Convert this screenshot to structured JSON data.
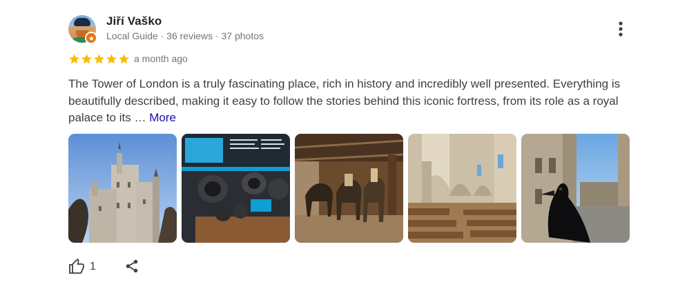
{
  "review": {
    "author": {
      "name": "Jiří Vaško",
      "meta": "Local Guide · 36 reviews · 37 photos",
      "avatar_icon": "user-avatar-icon",
      "badge_icon": "local-guide-star-icon"
    },
    "rating": {
      "stars": 5,
      "max": 5,
      "color": "#fbbc04"
    },
    "date": "a month ago",
    "text": "The Tower of London is a truly fascinating place, rich in history and incredibly well presented. Everything is beautifully described, making it easy to follow the stories behind this iconic fortress, from its role as a royal palace to its …",
    "more_label": "More",
    "photos": [
      {
        "name": "photo-white-tower",
        "subject": "white-tower"
      },
      {
        "name": "photo-cannons-exhibit",
        "subject": "cannons"
      },
      {
        "name": "photo-line-of-kings",
        "subject": "horses"
      },
      {
        "name": "photo-chapel-interior",
        "subject": "chapel"
      },
      {
        "name": "photo-raven",
        "subject": "raven"
      }
    ],
    "actions": {
      "like_icon": "thumbs-up-icon",
      "like_count": "1",
      "share_icon": "share-icon",
      "menu_icon": "more-vert-icon"
    }
  },
  "colors": {
    "text_primary": "#202124",
    "text_secondary": "#70757a",
    "link": "#1a0dab",
    "star": "#fbbc04",
    "badge": "#e8710a"
  }
}
